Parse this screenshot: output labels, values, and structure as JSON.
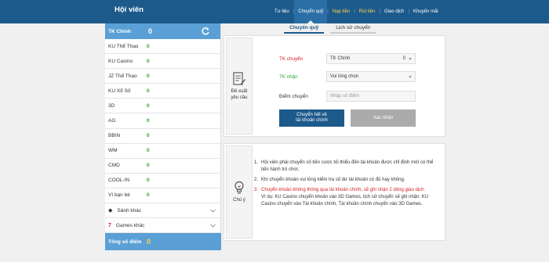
{
  "header": {
    "title": "Hội viên",
    "nav": [
      {
        "label": "Tư liệu",
        "color": "white",
        "active": false
      },
      {
        "label": "Chuyển quỹ",
        "color": "white",
        "active": true
      },
      {
        "label": "Nạp tiền",
        "color": "yellow",
        "active": false
      },
      {
        "label": "Rút tiền",
        "color": "yellow",
        "active": false
      },
      {
        "label": "Giao dịch",
        "color": "white",
        "active": false
      },
      {
        "label": "Khuyến mãi",
        "color": "white",
        "active": false
      }
    ]
  },
  "sidebar": {
    "main_label": "TK Chính",
    "main_value": "0",
    "refresh_icon": "refresh-icon",
    "items": [
      {
        "label": "KU Thể Thao",
        "value": "0"
      },
      {
        "label": "KU Casino",
        "value": "0"
      },
      {
        "label": "JZ Thể Thao",
        "value": "0"
      },
      {
        "label": "KU Xổ Số",
        "value": "0"
      },
      {
        "label": "3D",
        "value": "0"
      },
      {
        "label": "AG",
        "value": "0"
      },
      {
        "label": "BBIN",
        "value": "0"
      },
      {
        "label": "WM",
        "value": "0"
      },
      {
        "label": "CMD",
        "value": "0"
      },
      {
        "label": "COOL-IN",
        "value": "0"
      },
      {
        "label": "Vì bạn bè",
        "value": "0"
      }
    ],
    "groups": [
      {
        "label": "Sảnh khác",
        "icon": "diamond-icon"
      },
      {
        "label": "Games khác",
        "icon": "seven-icon"
      }
    ],
    "total_label": "Tổng số điểm",
    "total_value": "0"
  },
  "tabs": [
    {
      "label": "Chuyển quỹ",
      "active": true
    },
    {
      "label": "Lịch sử chuyển",
      "active": false
    }
  ],
  "transfer_panel": {
    "side_label_line1": "Đề xuất",
    "side_label_line2": "yêu cầu",
    "from_label": "TK chuyển",
    "from_value": "TK Chính",
    "from_amount": "0",
    "to_label": "TK nhận",
    "to_value": "Vui lòng chọn",
    "points_label": "Điểm chuyển",
    "points_placeholder": "Nhập số điểm",
    "transfer_all_line1": "Chuyển hết về",
    "transfer_all_line2": "tài khoản chính",
    "confirm_label": "Xác nhận"
  },
  "notes_panel": {
    "side_label": "Chú ý",
    "notes": [
      {
        "n": "1.",
        "text": "Hội viên phải chuyển số tiền cược tối thiểu đến tài khoản được chỉ định mới có thể tiến hành trò chơi.",
        "red": false
      },
      {
        "n": "2.",
        "text": "Khi chuyển khoản vui lòng kiểm tra số dư tài khoản có đủ hay không.",
        "red": false
      },
      {
        "n": "3.",
        "text": "Chuyển khoản không thông qua tài khoản chính, sẽ ghi nhận 2 dòng giao dịch.",
        "red": true
      }
    ],
    "example": "Ví dụ: KU Casino chuyển khoản vào 3D Games, lịch sử chuyển sẽ ghi nhận: KU Casino chuyển vào Tài khoản chính, Tài khoản chính chuyển vào 3D Games."
  },
  "colors": {
    "header_bg": "#1d5a8c",
    "sidebar_accent": "#5aa0d6",
    "positive": "#2ea82e",
    "warning": "#d32020",
    "highlight": "#ffd54a"
  }
}
